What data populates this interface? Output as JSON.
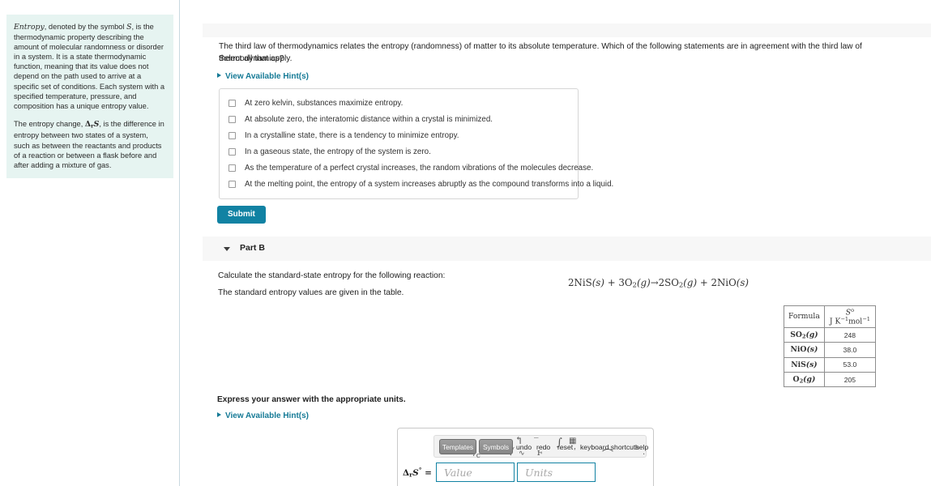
{
  "sidebar": {
    "paragraphs": [
      "Entropy, denoted by the symbol S, is the thermodynamic property describing the amount of molecular randomness or disorder in a system. It is a state thermodynamic function, meaning that its value does not depend on the path used to arrive at a specific set of conditions. Each system with a specified temperature, pressure, and composition has a unique entropy value.",
      "The entropy change, ΔrS, is the difference in entropy between two states of a system, such as between the reactants and products of a reaction or between a flask before and after adding a mixture of gas."
    ],
    "p1_lead_italic": "Entropy",
    "p1_rest": ", denoted by the symbol ",
    "p1_symbol": "S",
    "p1_tail": ", is the thermodynamic property describing the amount of molecular randomness or disorder in a system. It is a state thermodynamic function, meaning that its value does not depend on the path used to arrive at a specific set of conditions. Each system with a specified temperature, pressure, and composition has a unique entropy value.",
    "p2_head": "The entropy change, ",
    "p2_delta": "Δ",
    "p2_sub": "r",
    "p2_s": "S",
    "p2_tail": ", is the difference in entropy between two states of a system, such as between the reactants and products of a reaction or between a flask before and after adding a mixture of gas."
  },
  "partA": {
    "question": "The third law of thermodynamics relates the entropy (randomness) of matter to its absolute temperature. Which of the following statements are in agreement with the third law of thermodynamics?",
    "instruction": "Select all that apply.",
    "hint_label": "View Available Hint(s)",
    "choices": [
      "At zero kelvin, substances maximize entropy.",
      "At absolute zero, the interatomic distance within a crystal is minimized.",
      "In a crystalline state, there is a tendency to minimize entropy.",
      "In a gaseous state, the entropy of the system is zero.",
      "As the temperature of a perfect crystal increases, the random vibrations of the molecules decrease.",
      "At the melting point, the entropy of a system increases abruptly as the compound transforms into a liquid."
    ],
    "submit_label": "Submit"
  },
  "partB": {
    "title": "Part B",
    "line1": "Calculate the standard-state entropy for the following reaction:",
    "line2": "The standard entropy values are given in the table.",
    "equation": "2NiS(s) + 3O2(g)→2SO2(g) + 2NiO(s)",
    "equation_parts": {
      "r1_coef": "2",
      "r1_formula": "NiS",
      "r1_state": "(s)",
      "plus1": "+",
      "r2_coef": "3",
      "r2_formula": "O",
      "r2_sub": "2",
      "r2_state": "(g)",
      "arrow": "→",
      "p1_coef": "2",
      "p1_formula": "SO",
      "p1_sub": "2",
      "p1_state": "(g)",
      "plus2": "+",
      "p2_coef": "2",
      "p2_formula": "NiO",
      "p2_state": "(s)"
    },
    "table": {
      "header_formula": "Formula",
      "header_symbol": "S",
      "header_symbol_sup": "o",
      "header_units_j": "J K",
      "header_units_exp1": "−1",
      "header_units_mol": "mol",
      "header_units_exp2": "−1",
      "rows": [
        {
          "formula": "SO",
          "sub": "2",
          "state": "(g)",
          "value": "248"
        },
        {
          "formula": "NiO",
          "sub": "",
          "state": "(s)",
          "value": "38.0"
        },
        {
          "formula": "NiS",
          "sub": "",
          "state": "(s)",
          "value": "53.0"
        },
        {
          "formula": "O",
          "sub": "2",
          "state": "(g)",
          "value": "205"
        }
      ]
    },
    "express_label": "Express your answer with the appropriate units.",
    "hint_label": "View Available Hint(s)",
    "toolbar": {
      "templates": "Templates",
      "symbols": "Symbols",
      "undo": "undo",
      "redo": "redo",
      "reset": "reset",
      "keyboard_shortcuts": "keyboard shortcuts",
      "help": "help"
    },
    "answer": {
      "label_delta": "Δ",
      "label_sub": "r",
      "label_s": "S",
      "label_deg": "°",
      "label_eq": "=",
      "value_placeholder": "Value",
      "units_placeholder": "Units"
    }
  },
  "colors": {
    "accent": "#1182a3",
    "link": "#157a96",
    "hint_card_bg": "#e6f4f1",
    "band_bg": "#f7f7f7"
  }
}
